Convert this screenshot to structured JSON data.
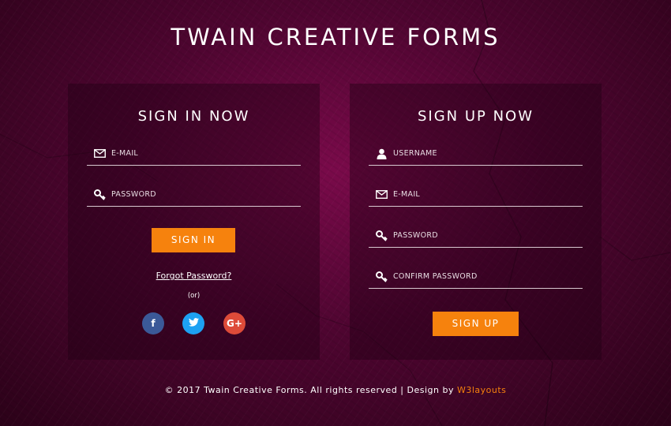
{
  "page": {
    "title": "TWAIN CREATIVE FORMS"
  },
  "signin": {
    "heading": "SIGN IN NOW",
    "email_placeholder": "E-MAIL",
    "password_placeholder": "PASSWORD",
    "button": "SIGN IN",
    "forgot": "Forgot Password?",
    "or": "(or)",
    "social": [
      {
        "name": "facebook",
        "glyph": "f",
        "color": "#3b5998"
      },
      {
        "name": "twitter",
        "glyph": "t",
        "color": "#1da1f2"
      },
      {
        "name": "google-plus",
        "glyph": "G+",
        "color": "#dd4b39"
      }
    ]
  },
  "signup": {
    "heading": "SIGN UP NOW",
    "username_placeholder": "USERNAME",
    "email_placeholder": "E-MAIL",
    "password_placeholder": "PASSWORD",
    "confirm_placeholder": "CONFIRM PASSWORD",
    "button": "SIGN UP"
  },
  "footer": {
    "text": "© 2017 Twain Creative Forms. All rights reserved | Design by ",
    "link": "W3layouts"
  },
  "colors": {
    "accent": "#f6820d",
    "background": "#5a0636"
  }
}
